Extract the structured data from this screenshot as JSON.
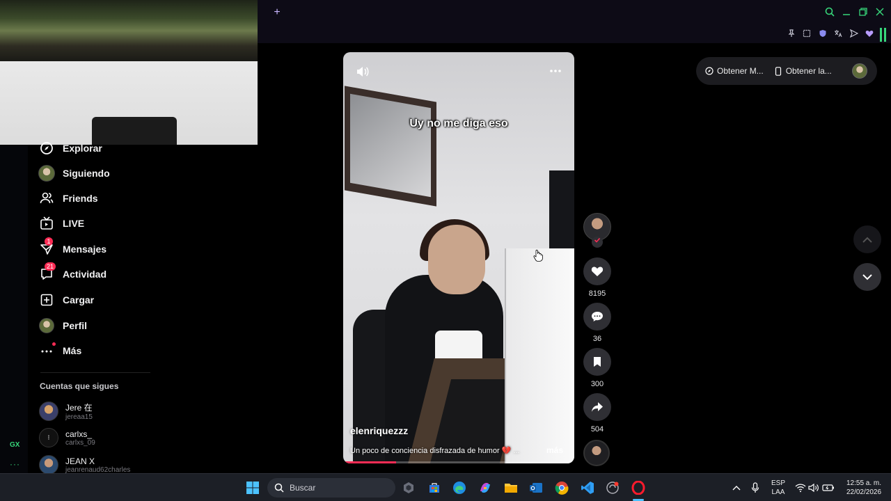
{
  "sidebar": {
    "items": [
      {
        "label": "Explorar",
        "icon": "compass-icon"
      },
      {
        "label": "Siguiendo",
        "icon": "avatar"
      },
      {
        "label": "Friends",
        "icon": "friends-icon"
      },
      {
        "label": "LIVE",
        "icon": "live-icon"
      },
      {
        "label": "Mensajes",
        "icon": "messages-icon",
        "badge": "1"
      },
      {
        "label": "Actividad",
        "icon": "activity-icon",
        "badge": "21"
      },
      {
        "label": "Cargar",
        "icon": "upload-icon"
      },
      {
        "label": "Perfil",
        "icon": "avatar"
      },
      {
        "label": "Más",
        "icon": "more-icon"
      }
    ],
    "following_title": "Cuentas que sigues",
    "accounts": [
      {
        "name": "Jere 在",
        "handle": "jereaa15"
      },
      {
        "name": "carlxs_",
        "handle": "carlxs_09"
      },
      {
        "name": "JEAN X",
        "handle": "jeanrenaud62charles"
      }
    ]
  },
  "video": {
    "caption": "Uy no me diga eso",
    "username": "elenriquezzz",
    "description": "Un poco de conciencia disfrazada de humor 💔 ...",
    "more_label": "más",
    "progress": 0.23
  },
  "actions": {
    "likes": "8195",
    "comments": "36",
    "saves": "300",
    "shares": "504"
  },
  "pill": {
    "item1": "Obtener M...",
    "item2": "Obtener la..."
  },
  "browser": {
    "rail_logo": "GX",
    "rail_more": "···"
  },
  "taskbar": {
    "search_placeholder": "Buscar",
    "lang_line1": "ESP",
    "lang_line2": "LAA",
    "time": "12:55 a. m.",
    "date": "22/02/2026"
  },
  "colors": {
    "accent": "#fe2c55",
    "gx_green": "#37d67a",
    "background": "#000000"
  }
}
